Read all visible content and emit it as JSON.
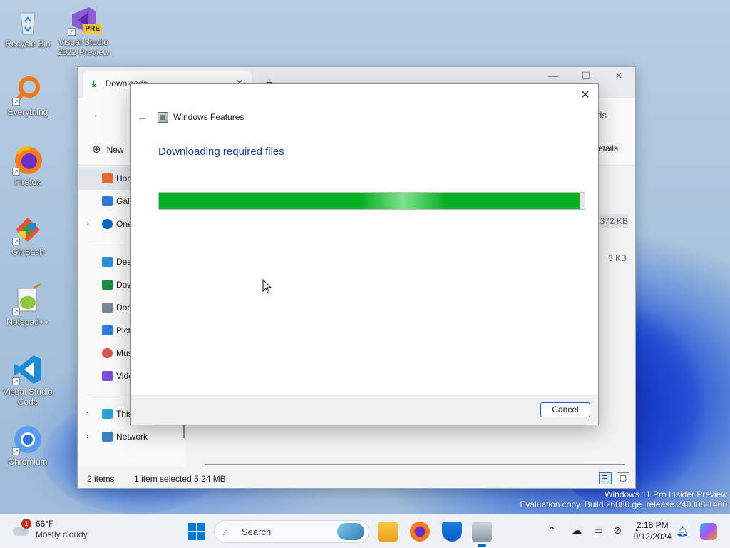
{
  "desktop": {
    "icons": [
      {
        "label": "Recycle Bin"
      },
      {
        "label": "Visual Studio 2022 Preview",
        "badge": "PRE"
      },
      {
        "label": "Everything"
      },
      {
        "label": "Firefox"
      },
      {
        "label": "Git Bash"
      },
      {
        "label": "Notepad++"
      },
      {
        "label": "Visual Studio Code"
      },
      {
        "label": "Chromium"
      }
    ],
    "watermark": {
      "line1": "Windows 11 Pro Insider Preview",
      "line2": "Evaluation copy. Build 26080.ge_release.240308-1400"
    }
  },
  "explorer": {
    "tab_title": "Downloads",
    "nav_crumb_end": "ds",
    "new_label": "New",
    "details_label": "etails",
    "sidebar": {
      "quick": [
        {
          "label": "Hor",
          "icon": "home-icon",
          "color": "#e86a2d"
        },
        {
          "label": "Gall",
          "icon": "gallery-icon",
          "color": "#2b7bd6"
        },
        {
          "label": "One",
          "icon": "onedrive-icon",
          "color": "#0a64c2"
        }
      ],
      "folders": [
        {
          "label": "Desk",
          "icon": "desktop-icon",
          "color": "#2a8fd6"
        },
        {
          "label": "Dow",
          "icon": "download-icon",
          "color": "#1e8a3c"
        },
        {
          "label": "Doc",
          "icon": "documents-icon",
          "color": "#7a8694"
        },
        {
          "label": "Pict",
          "icon": "pictures-icon",
          "color": "#2a7fd6"
        },
        {
          "label": "Mus",
          "icon": "music-icon",
          "color": "#d9534f"
        },
        {
          "label": "Vide",
          "icon": "videos-icon",
          "color": "#7b4fd6"
        }
      ],
      "this_pc": "This PC",
      "network": "Network"
    },
    "sizes": [
      "372 KB",
      "3 KB"
    ],
    "status": {
      "items": "2 items",
      "selected": "1 item selected  5.24 MB"
    }
  },
  "dialog": {
    "title": "Windows Features",
    "heading": "Downloading required files",
    "progress": 0.99,
    "cancel_label": "Cancel",
    "progress_color": "#06b025"
  },
  "taskbar": {
    "weather_temp": "66°F",
    "weather_cond": "Mostly cloudy",
    "weather_badge": "1",
    "search_placeholder": "Search",
    "time": "2:18 PM",
    "date": "9/12/2024"
  }
}
